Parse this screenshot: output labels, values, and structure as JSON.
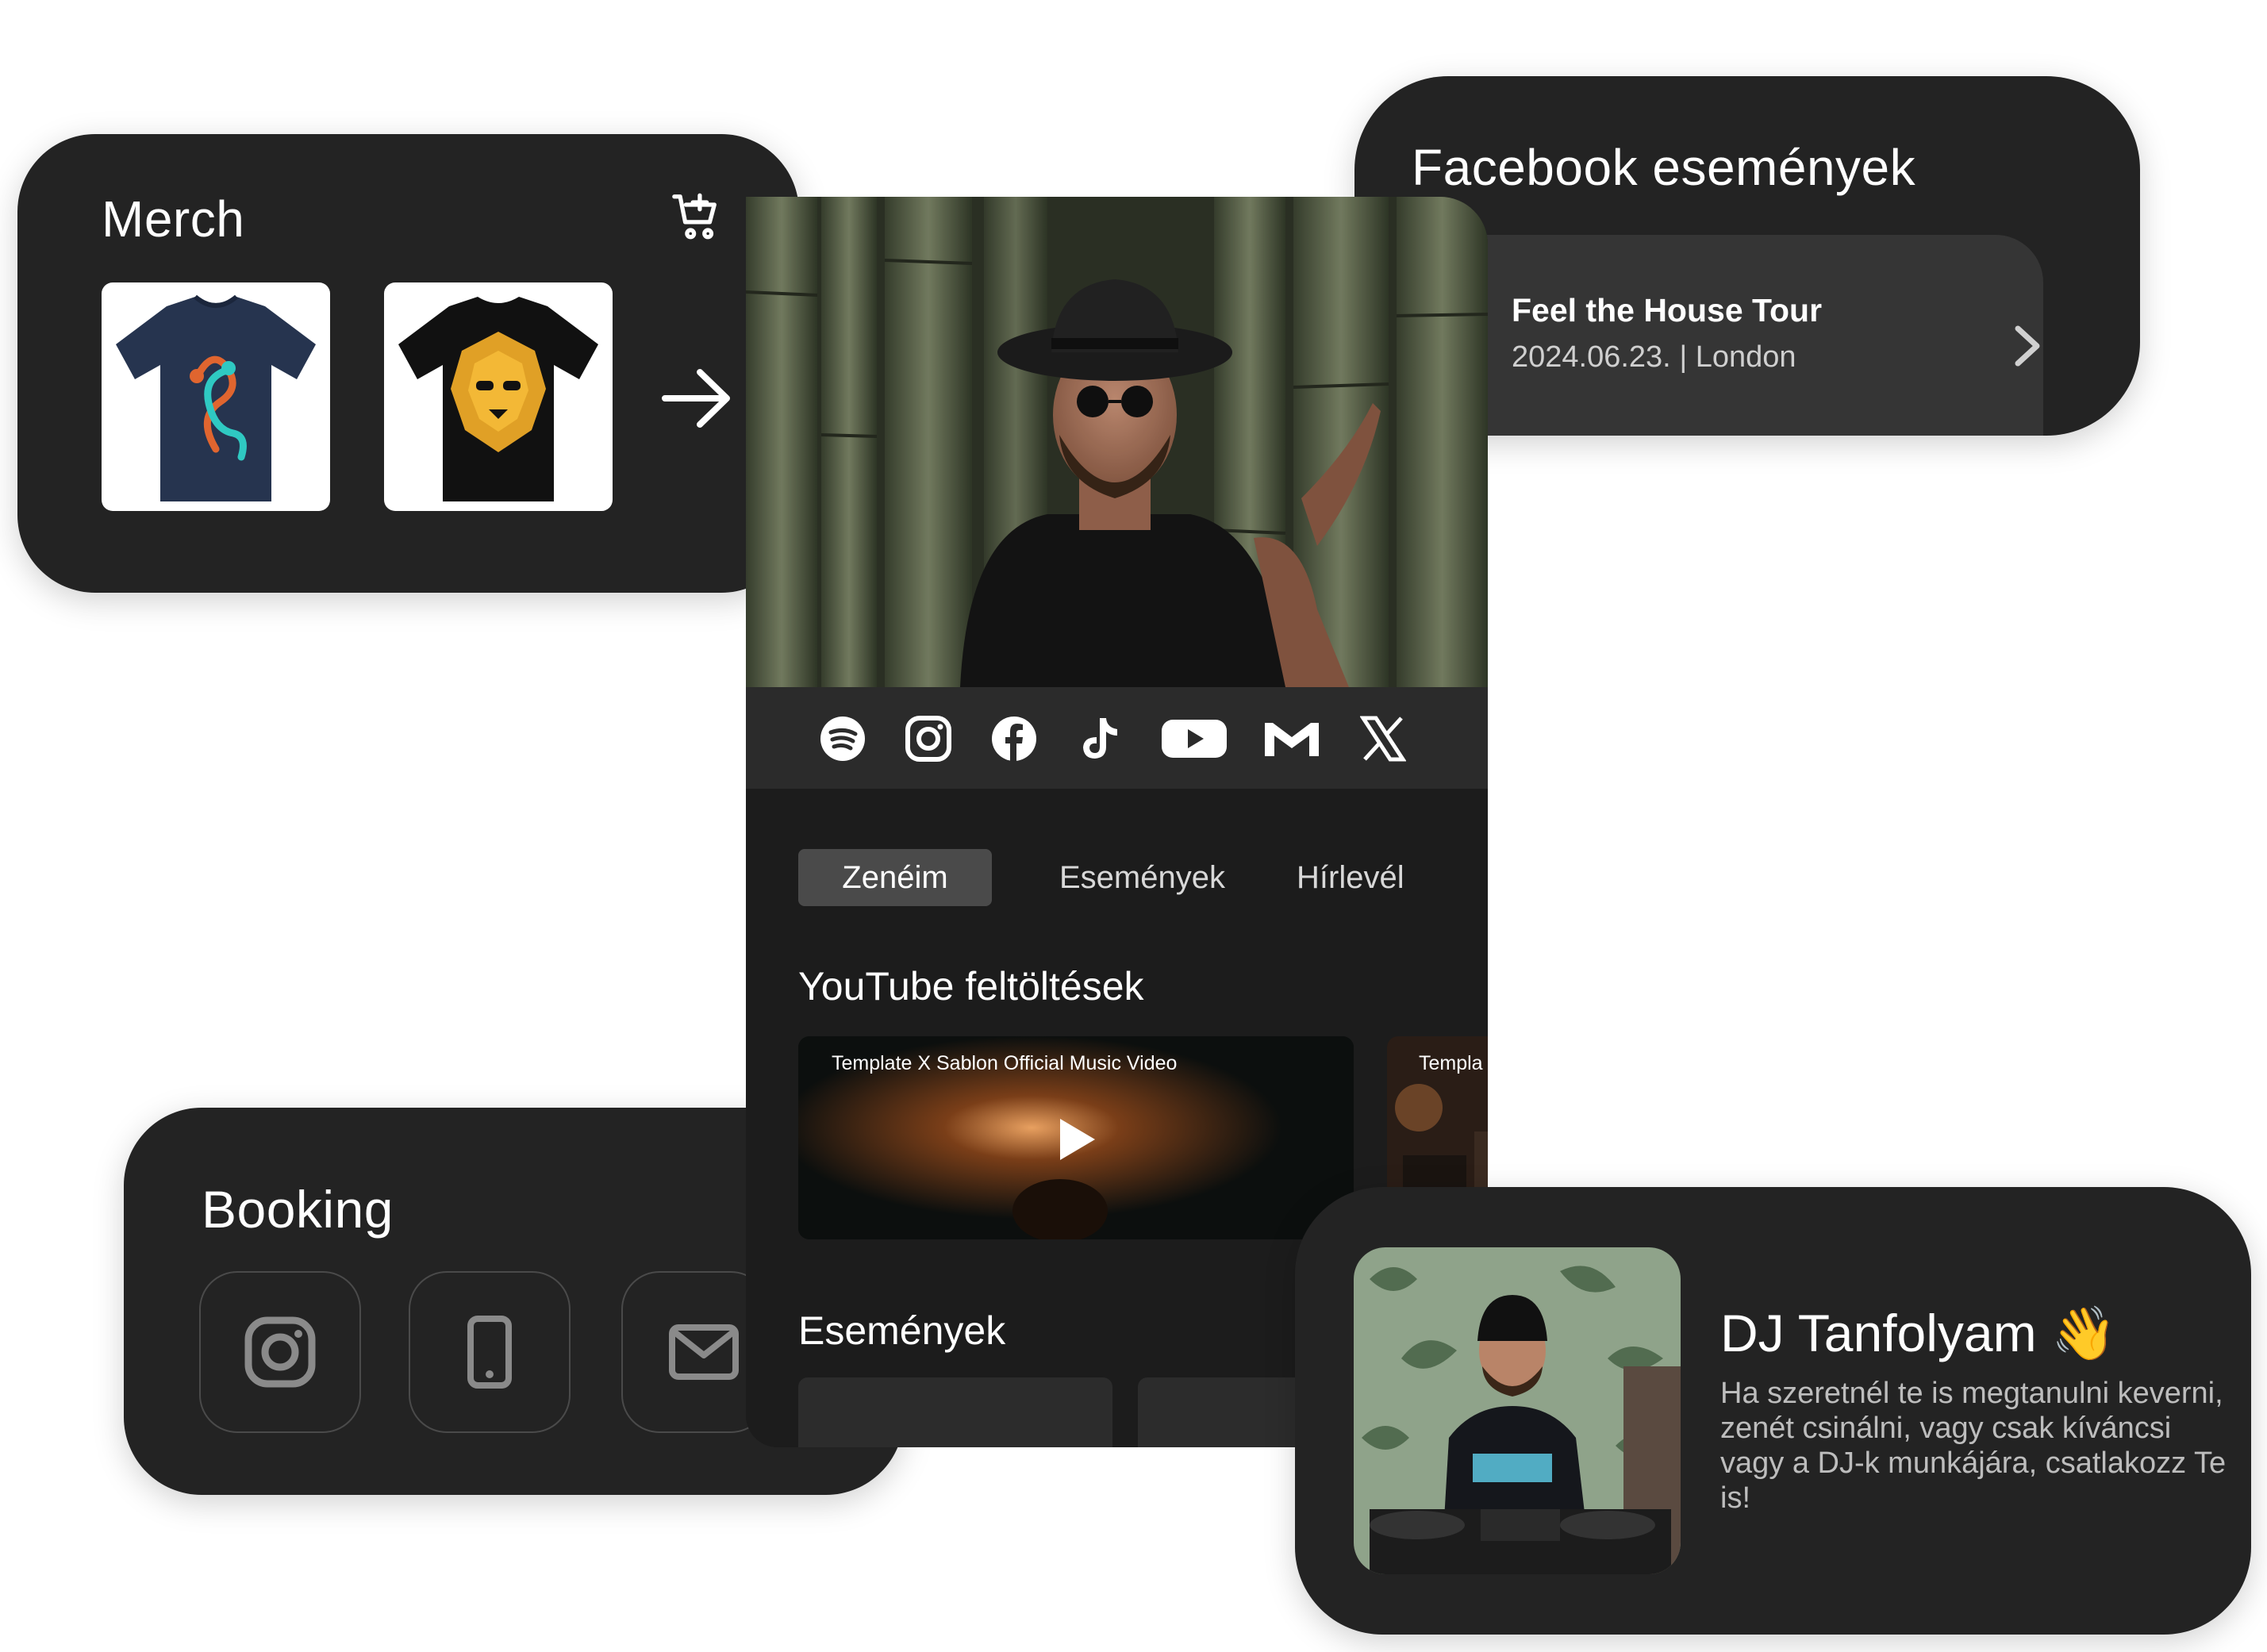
{
  "merch": {
    "title": "Merch",
    "cart_icon": "cart-plus-icon",
    "next_icon": "arrow-right-icon"
  },
  "facebook": {
    "title": "Facebook események",
    "event": {
      "title": "Feel the House Tour",
      "date": "2024.06.23.",
      "separator": "|",
      "location": "London"
    }
  },
  "profile": {
    "social_icons": [
      "spotify-icon",
      "instagram-icon",
      "facebook-icon",
      "tiktok-icon",
      "youtube-icon",
      "gmail-icon",
      "x-icon"
    ],
    "tabs": [
      "Zenéim",
      "Események",
      "Hírlevél"
    ],
    "youtube_section": "YouTube feltöltések",
    "videos": [
      {
        "caption": "Template X Sablon Official Music Video"
      },
      {
        "caption": "Templa"
      }
    ],
    "events_section": "Események"
  },
  "booking": {
    "title": "Booking",
    "contacts": [
      "instagram-icon",
      "phone-icon",
      "mail-icon"
    ]
  },
  "dj_course": {
    "title": "DJ Tanfolyam 👋",
    "description": "Ha szeretnél te is megtanulni keverni, zenét csinálni, vagy csak kíváncsi vagy a DJ-k munkájára, csatlakozz Te is!"
  },
  "colors": {
    "card_bg": "#232323",
    "inner_bg": "#353535",
    "tab_active": "#4a4a4a",
    "panel_bg": "#1c1c1c"
  }
}
